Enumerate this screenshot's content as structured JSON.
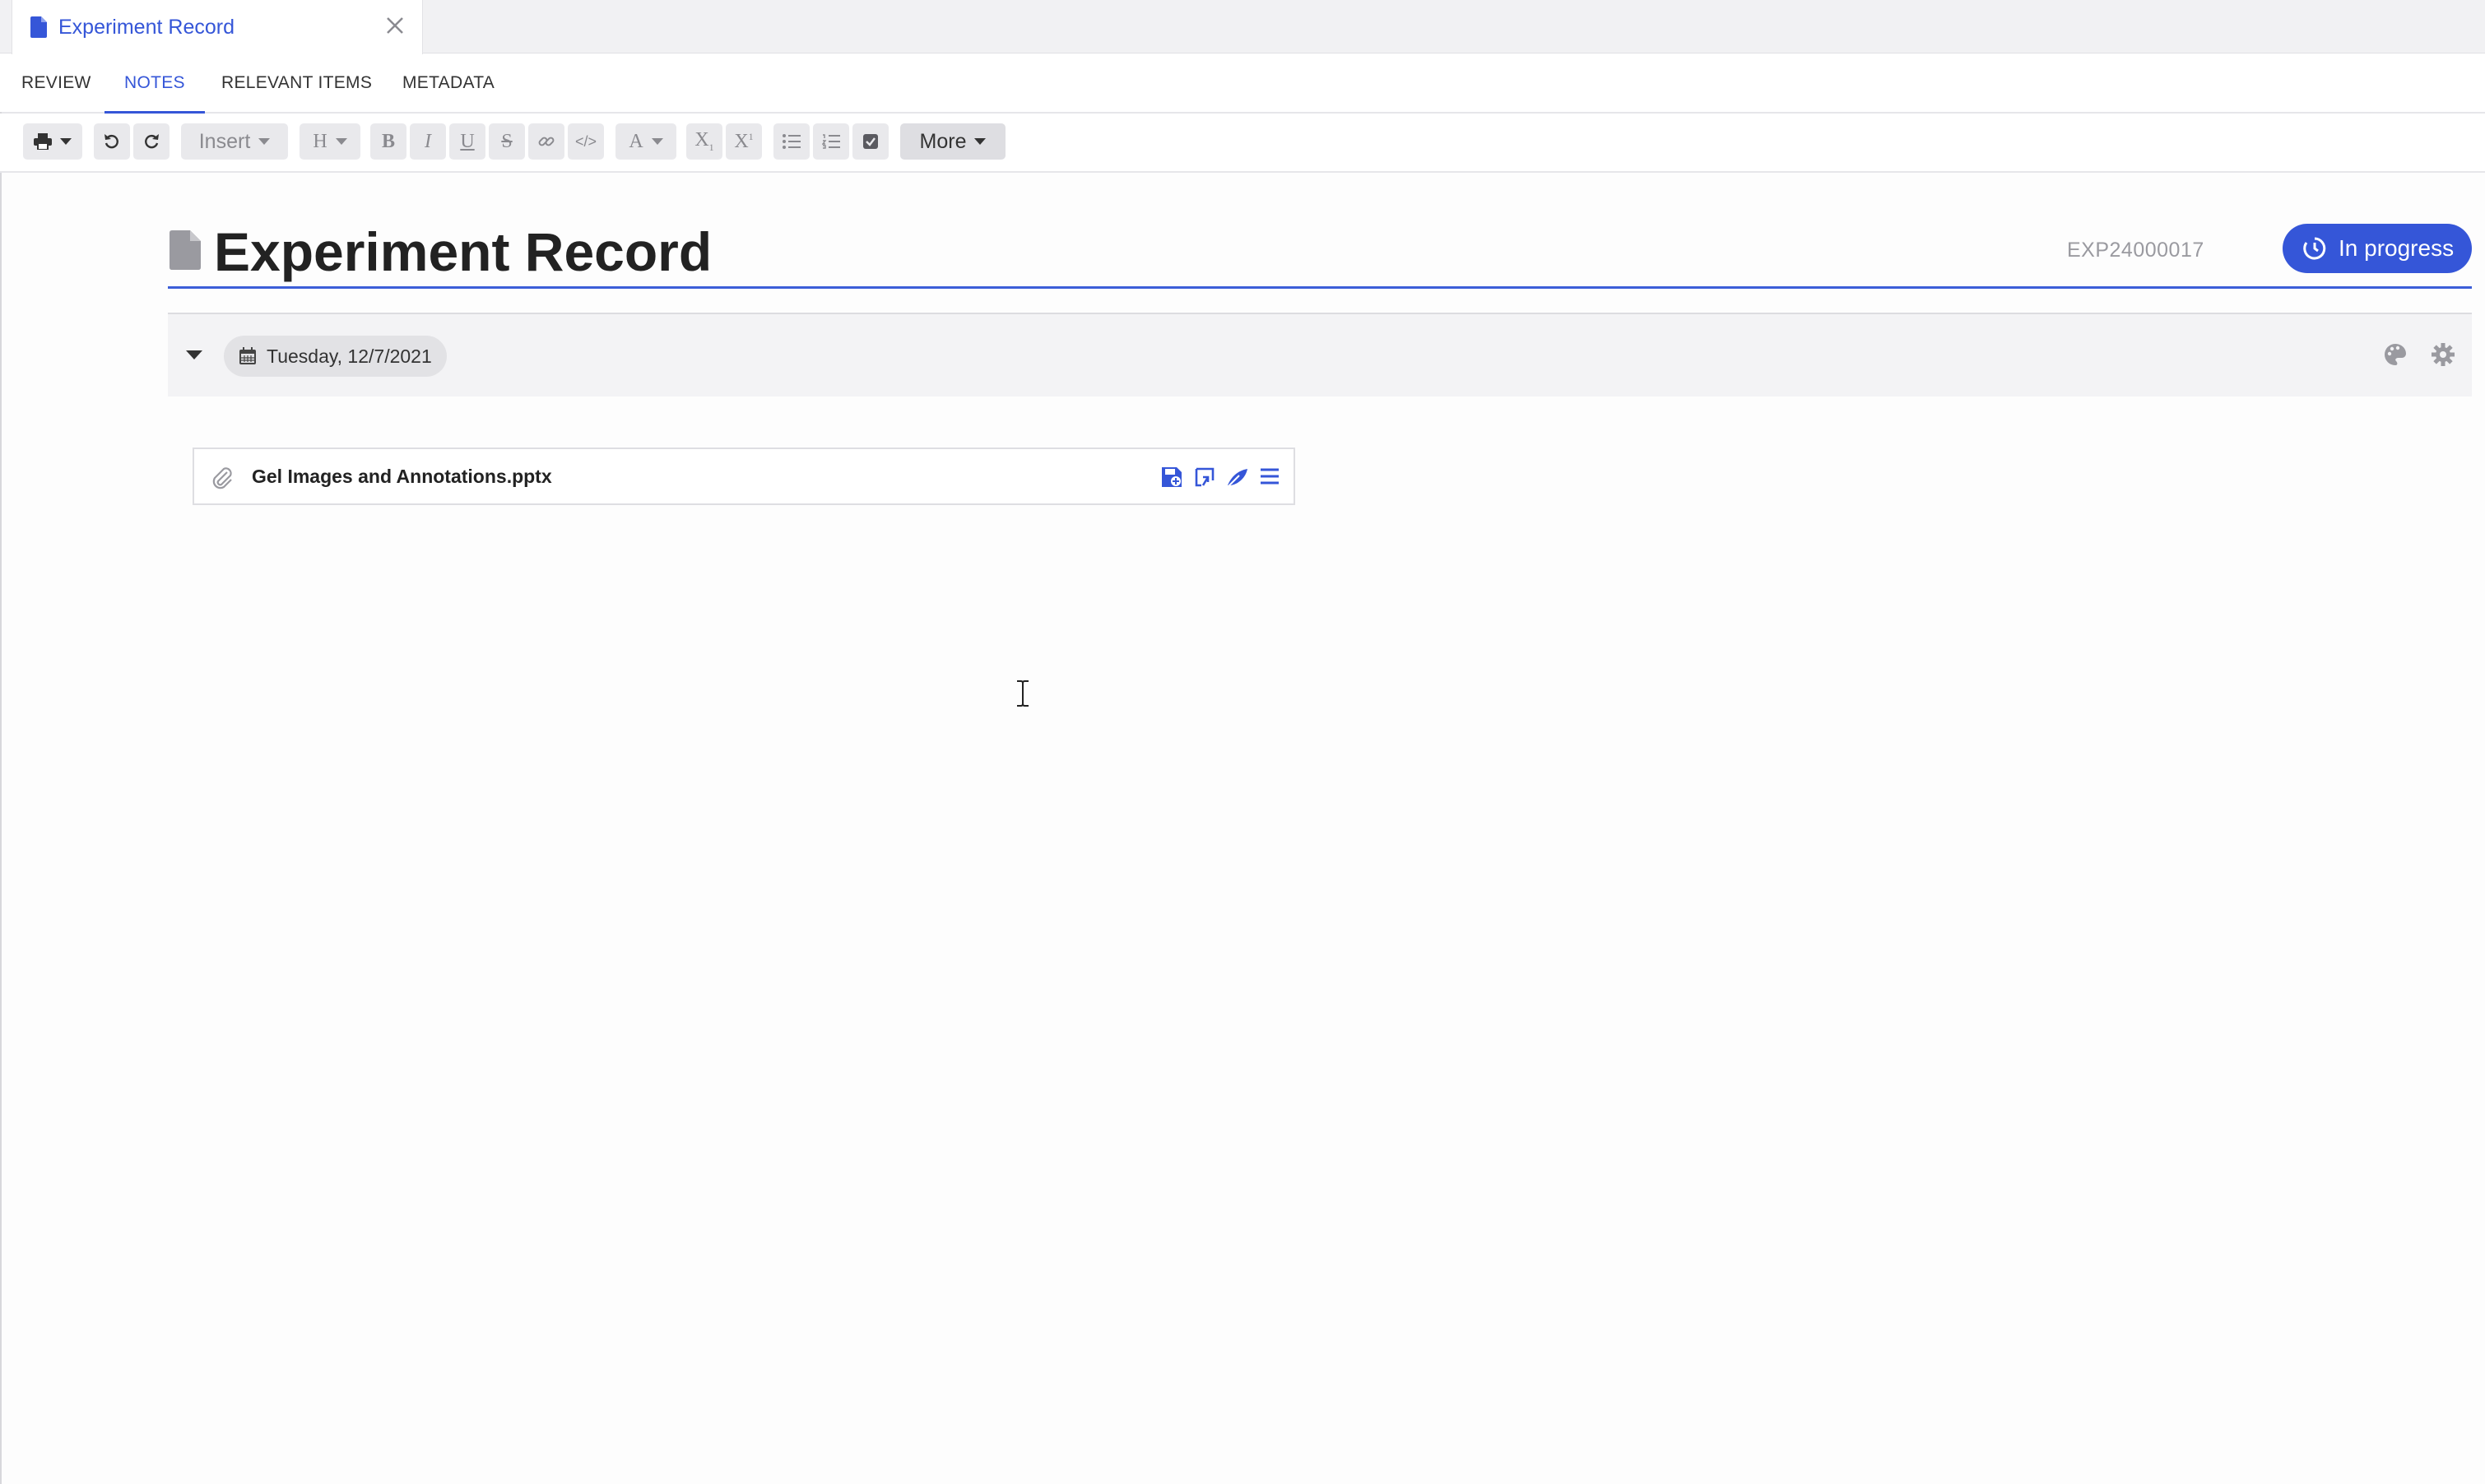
{
  "window": {
    "tab_title": "Experiment Record"
  },
  "subtabs": [
    {
      "label": "REVIEW"
    },
    {
      "label": "NOTES",
      "active": true
    },
    {
      "label": "RELEVANT ITEMS"
    },
    {
      "label": "METADATA"
    }
  ],
  "toolbar": {
    "insert_label": "Insert",
    "heading_label": "H",
    "font_color_label": "A",
    "more_label": "More"
  },
  "document": {
    "title": "Experiment Record",
    "id": "EXP24000017",
    "status": "In progress"
  },
  "entry": {
    "date": "Tuesday, 12/7/2021"
  },
  "attachment": {
    "filename": "Gel Images and Annotations.pptx"
  },
  "colors": {
    "accent": "#3556d8",
    "toolbar_button": "#e9e9ec"
  }
}
